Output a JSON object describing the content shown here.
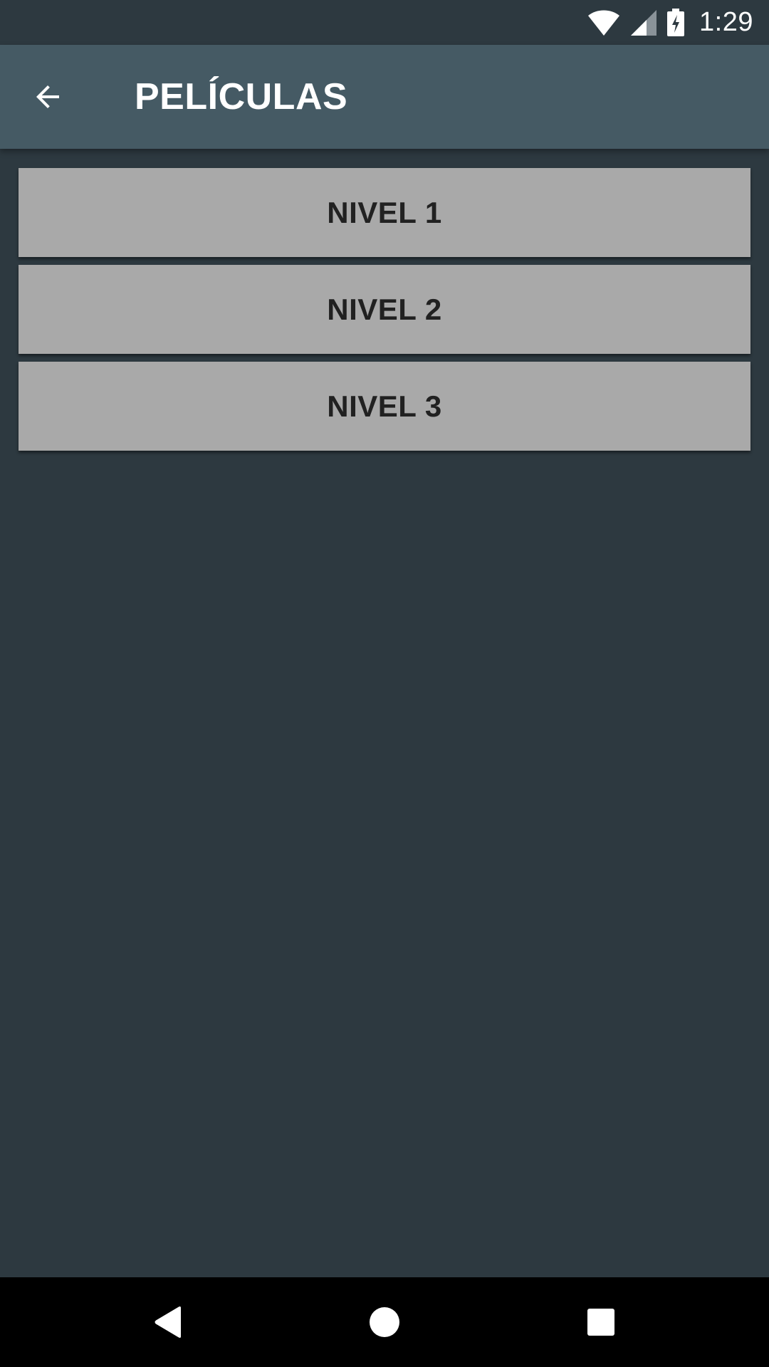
{
  "status_bar": {
    "time": "1:29",
    "icons": [
      "wifi-icon",
      "cell-signal-icon",
      "battery-charging-icon"
    ]
  },
  "app_bar": {
    "title": "PELÍCULAS",
    "back_icon": "arrow-back-icon"
  },
  "levels": [
    {
      "label": "NIVEL 1"
    },
    {
      "label": "NIVEL 2"
    },
    {
      "label": "NIVEL 3"
    }
  ],
  "nav_bar": {
    "icons": [
      "back-triangle-icon",
      "home-circle-icon",
      "recents-square-icon"
    ]
  },
  "colors": {
    "background": "#2d3940",
    "app_bar": "#455a64",
    "button": "#a9a9a9",
    "button_text": "#212121"
  }
}
